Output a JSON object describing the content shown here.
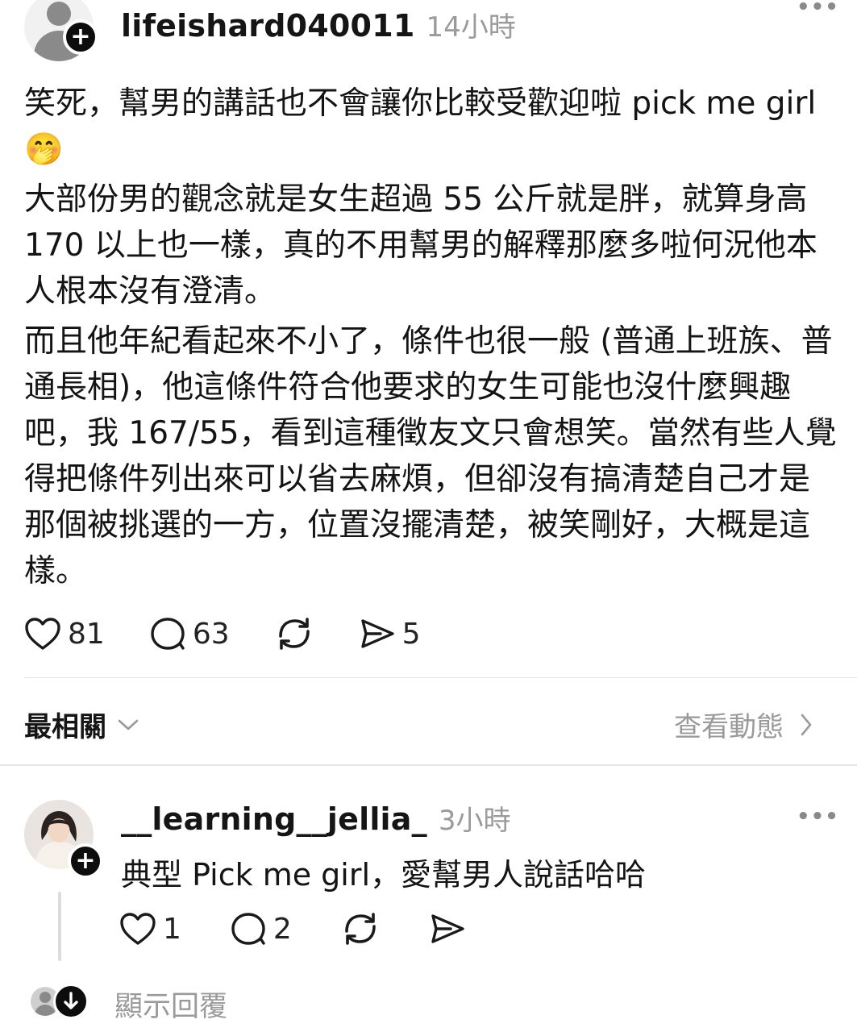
{
  "post": {
    "username": "lifeishard040011",
    "time": "14小時",
    "paragraphs": [
      "笑死，幫男的講話也不會讓你比較受歡迎啦 pick me girl🤭",
      "大部份男的觀念就是女生超過 55 公斤就是胖，就算身高 170 以上也一樣，真的不用幫男的解釋那麼多啦何況他本人根本沒有澄清。",
      "而且他年紀看起來不小了，條件也很一般 (普通上班族、普通長相)，他這條件符合他要求的女生可能也沒什麼興趣吧，我 167/55，看到這種徵友文只會想笑。當然有些人覺得把條件列出來可以省去麻煩，但卻沒有搞清楚自己才是那個被挑選的一方，位置沒擺清楚，被笑剛好，大概是這樣。"
    ],
    "likes": "81",
    "comments": "63",
    "shares": "5"
  },
  "replies_header": {
    "sort_label": "最相關",
    "view_activity": "查看動態"
  },
  "reply": {
    "username": "__learning__jellia_",
    "time": "3小時",
    "text": "典型 Pick me girl，愛幫男人說話哈哈",
    "likes": "1",
    "comments": "2"
  },
  "show_replies": "顯示回覆",
  "colors": {
    "text": "#141414",
    "muted": "#9a9a9a",
    "divider": "#e6e6e6",
    "badge": "#0d0d0d"
  }
}
